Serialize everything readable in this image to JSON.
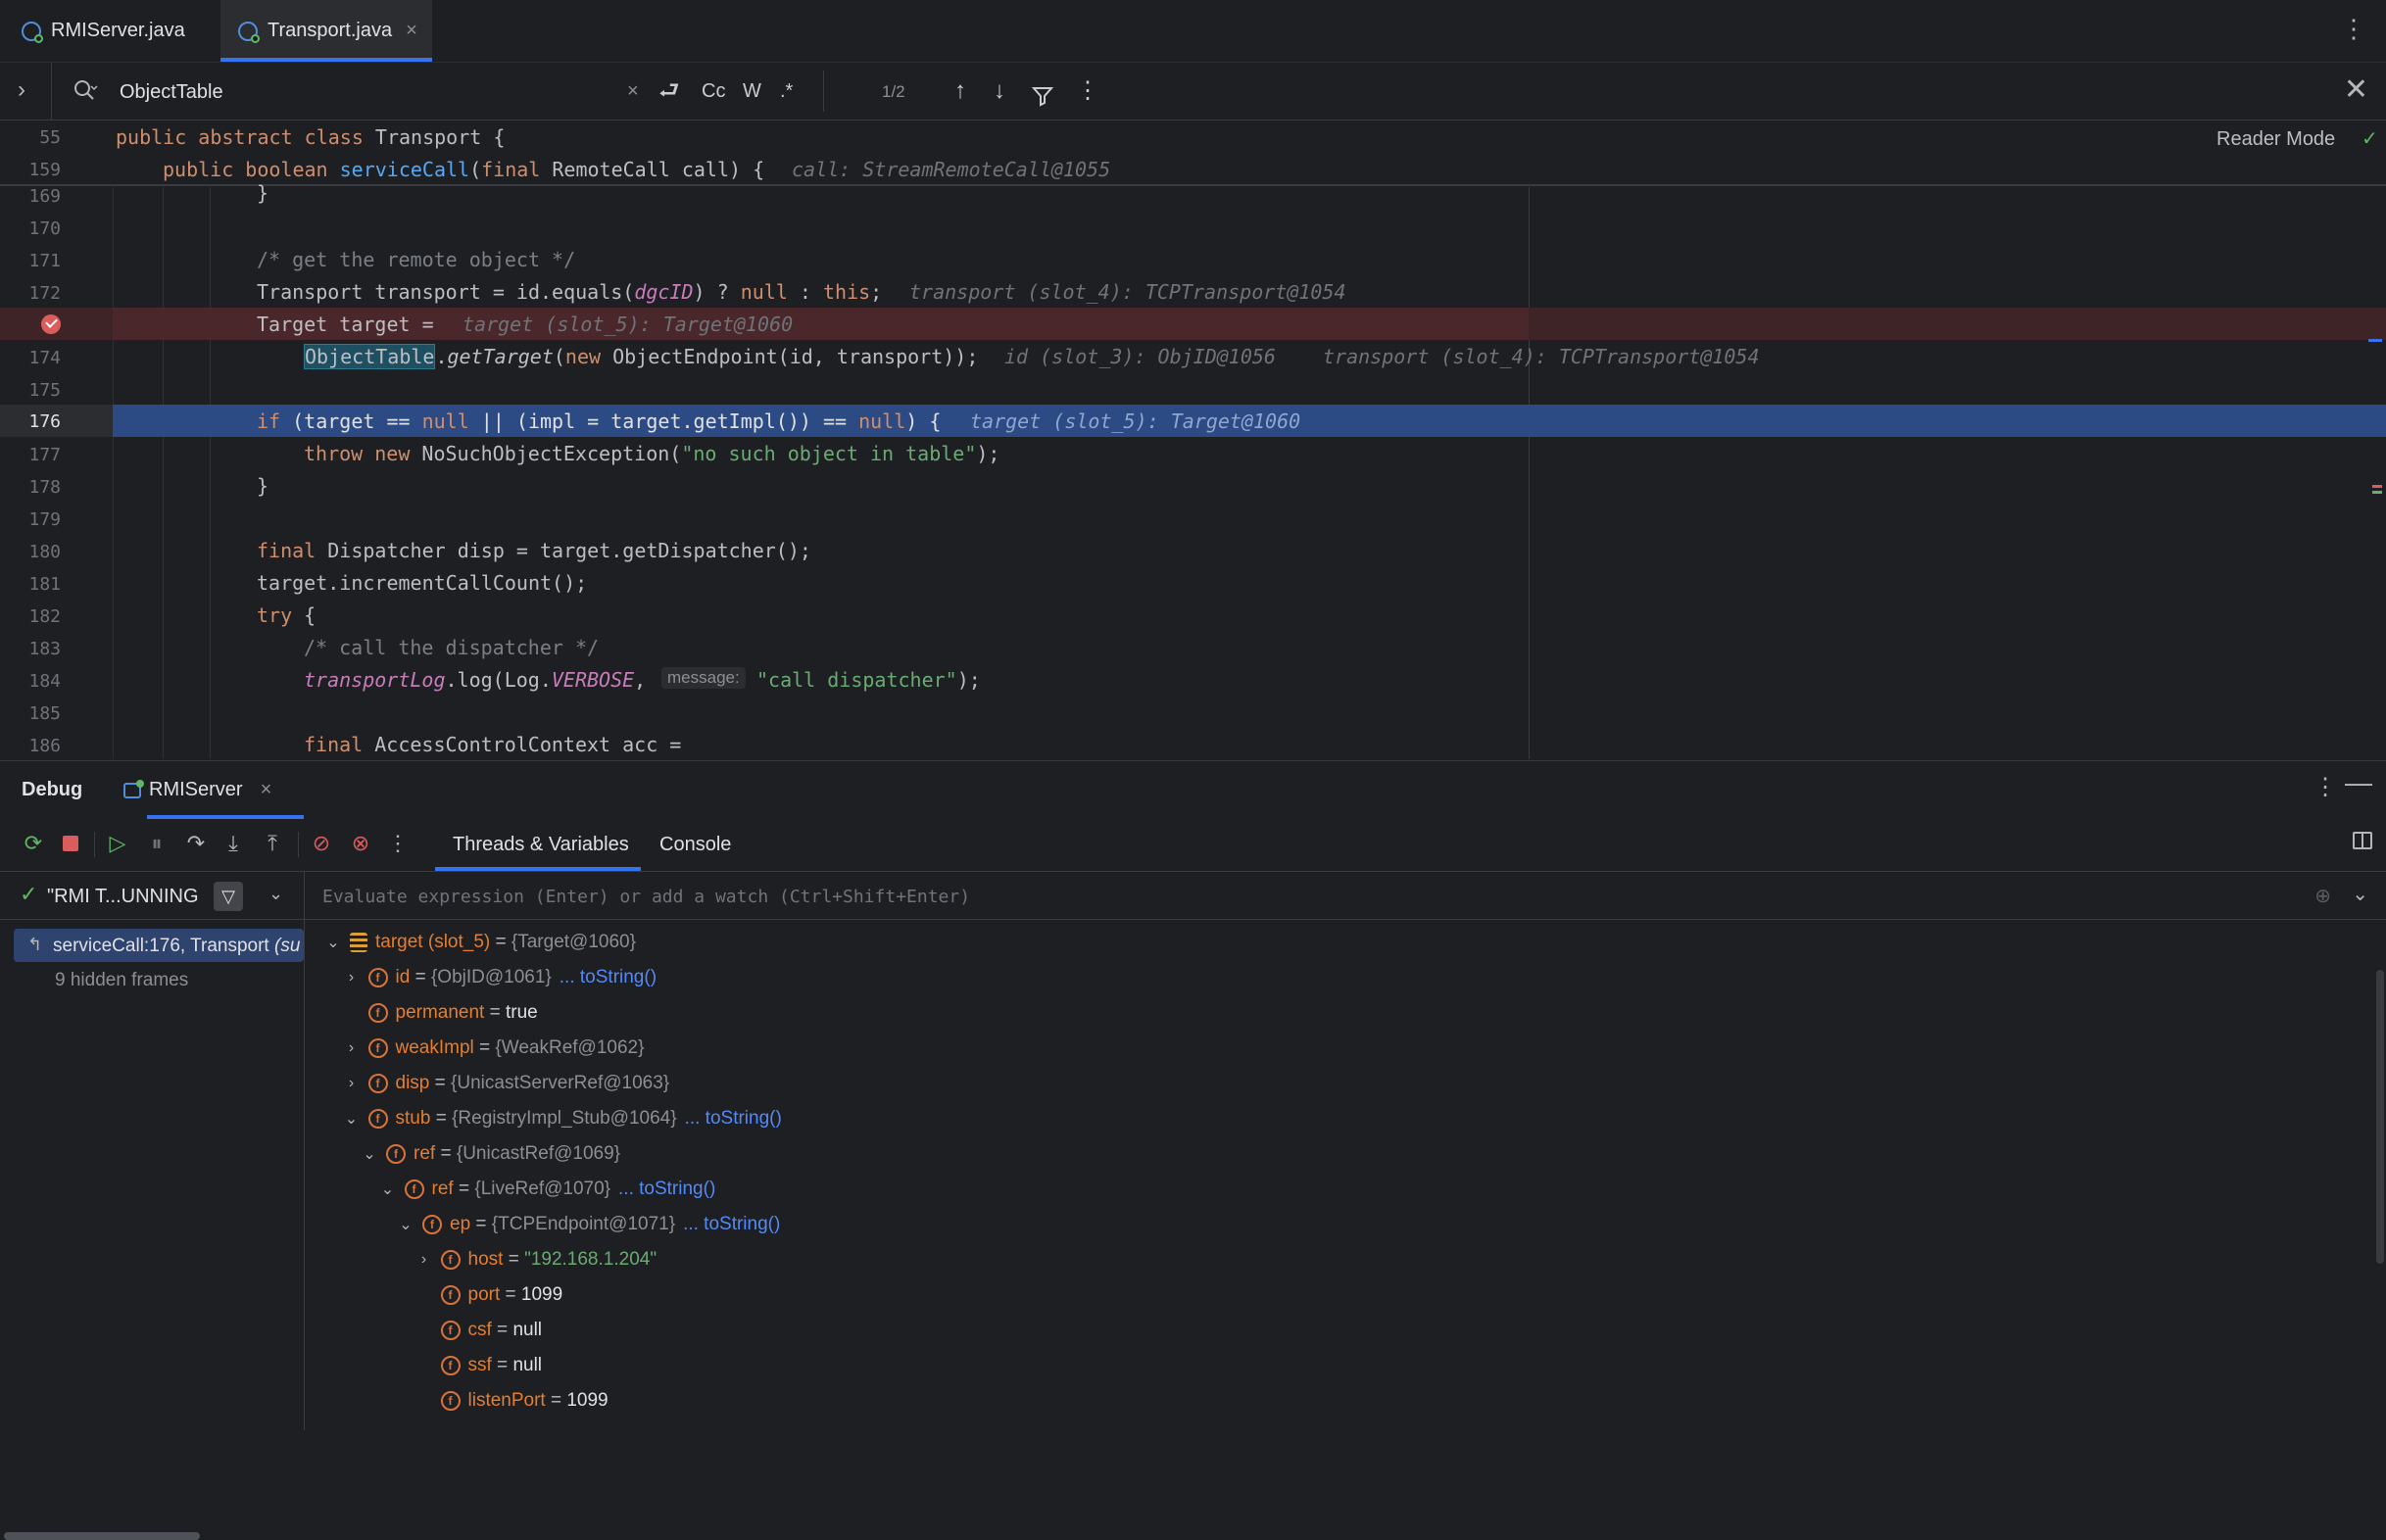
{
  "tabs": [
    {
      "label": "RMIServer.java",
      "active": false
    },
    {
      "label": "Transport.java",
      "active": true
    }
  ],
  "search": {
    "value": "ObjectTable",
    "count": "1/2",
    "case_label": "Cc",
    "word_label": "W",
    "regex_label": ".*"
  },
  "editor": {
    "reader_mode": "Reader Mode",
    "sticky": [
      {
        "ln": "55",
        "code": "public abstract class Transport {"
      },
      {
        "ln": "159",
        "code": "public boolean serviceCall(final RemoteCall call) {",
        "hint": "call: StreamRemoteCall@1055"
      }
    ],
    "lines": {
      "l169": "169",
      "l170": "170",
      "l171": "171",
      "l172": "172",
      "l174": "174",
      "l175": "175",
      "l176": "176",
      "l177": "177",
      "l178": "178",
      "l179": "179",
      "l180": "180",
      "l181": "181",
      "l182": "182",
      "l183": "183",
      "l184": "184",
      "l185": "185",
      "l186": "186"
    },
    "hints": {
      "h172": "transport (slot_4): TCPTransport@1054",
      "h173": "target (slot_5): Target@1060",
      "h174a": "id (slot_3): ObjID@1056",
      "h174b": "transport (slot_4): TCPTransport@1054",
      "h176": "target (slot_5): Target@1060",
      "param": "message:"
    }
  },
  "debug": {
    "title": "Debug",
    "session": "RMIServer",
    "tabs": [
      "Threads & Variables",
      "Console"
    ],
    "thread": "\"RMI T...UNNING",
    "frame": "serviceCall:176, Transport",
    "frame_suffix": "(su",
    "hidden_frames": "9 hidden frames",
    "eval_placeholder": "Evaluate expression (Enter) or add a watch (Ctrl+Shift+Enter)"
  },
  "variables": [
    {
      "name": "target (slot_5)",
      "type": "{Target@1060}",
      "value": "",
      "link": "",
      "kind": "stack",
      "arrow": "v"
    },
    {
      "name": "id",
      "type": "{ObjID@1061}",
      "value": "",
      "link": "... toString()",
      "kind": "field-final",
      "arrow": ">"
    },
    {
      "name": "permanent",
      "type": "",
      "value": "true",
      "link": "",
      "kind": "field-final",
      "arrow": ""
    },
    {
      "name": "weakImpl",
      "type": "{WeakRef@1062}",
      "value": "",
      "link": "",
      "kind": "field-final",
      "arrow": ">"
    },
    {
      "name": "disp",
      "type": "{UnicastServerRef@1063}",
      "value": "",
      "link": "",
      "kind": "field",
      "arrow": ">"
    },
    {
      "name": "stub",
      "type": "{RegistryImpl_Stub@1064}",
      "value": "",
      "link": "... toString()",
      "kind": "field-final",
      "arrow": "v"
    },
    {
      "name": "ref",
      "type": "{UnicastRef@1069}",
      "value": "",
      "link": "",
      "kind": "field",
      "arrow": "v"
    },
    {
      "name": "ref",
      "type": "{LiveRef@1070}",
      "value": "",
      "link": "... toString()",
      "kind": "field",
      "arrow": "v"
    },
    {
      "name": "ep",
      "type": "{TCPEndpoint@1071}",
      "value": "",
      "link": "... toString()",
      "kind": "field-final",
      "arrow": "v"
    },
    {
      "name": "host",
      "type": "",
      "value": "\"192.168.1.204\"",
      "link": "",
      "kind": "field",
      "arrow": ">"
    },
    {
      "name": "port",
      "type": "",
      "value": "1099",
      "link": "",
      "kind": "field",
      "arrow": ""
    },
    {
      "name": "csf",
      "type": "",
      "value": "null",
      "link": "",
      "kind": "field-final",
      "arrow": ""
    },
    {
      "name": "ssf",
      "type": "",
      "value": "null",
      "link": "",
      "kind": "field-final",
      "arrow": ""
    },
    {
      "name": "listenPort",
      "type": "",
      "value": "1099",
      "link": "",
      "kind": "field",
      "arrow": ""
    }
  ],
  "colors": {
    "accent": "#3574f0",
    "exec_line": "#2c4a84",
    "breakpoint_line": "#3e2327",
    "breakpoint": "#db5c5c",
    "keyword": "#cf8e6d",
    "string": "#6aab73",
    "field_name": "#e67e2e"
  }
}
